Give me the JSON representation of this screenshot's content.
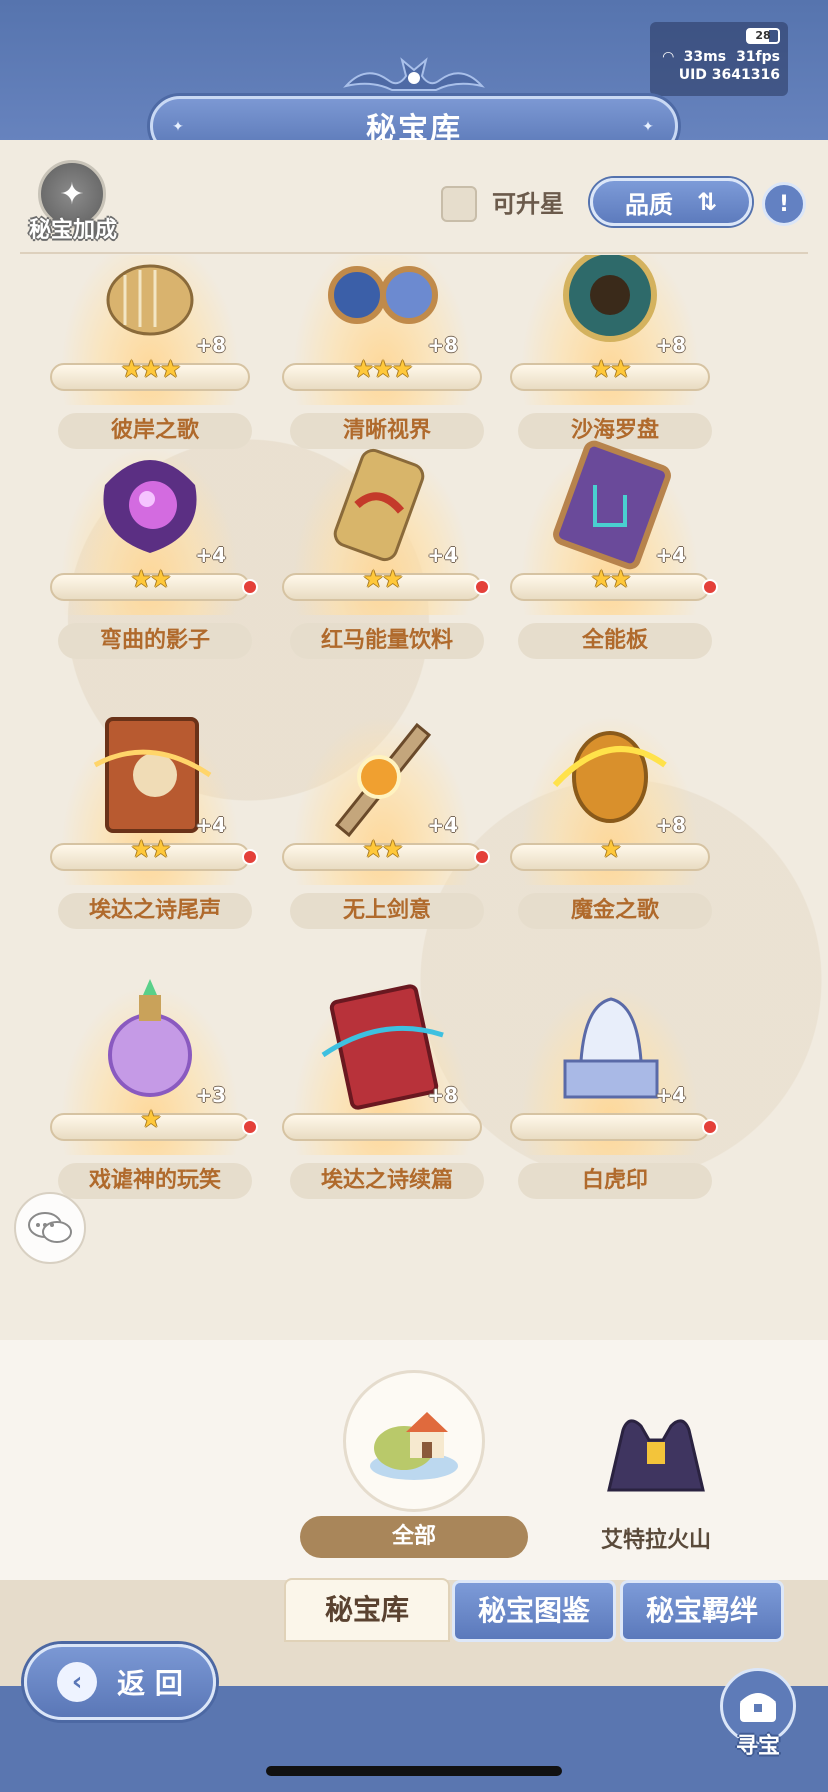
{
  "status": {
    "battery": "28",
    "ping": "33ms",
    "fps": "31fps",
    "uid": "UID 3641316"
  },
  "header": {
    "title": "秘宝库"
  },
  "filter": {
    "bonus_label": "秘宝加成",
    "upgradeable_label": "可升星",
    "quality_label": "品质"
  },
  "items": [
    {
      "name": "彼岸之歌",
      "level": "+8",
      "stars": "★★★",
      "new": false,
      "icon": "lyre-icon"
    },
    {
      "name": "清晰视界",
      "level": "+8",
      "stars": "★★★",
      "new": false,
      "icon": "goggles-icon"
    },
    {
      "name": "沙海罗盘",
      "level": "+8",
      "stars": "★★",
      "new": false,
      "icon": "compass-icon"
    },
    {
      "name": "弯曲的影子",
      "level": "+4",
      "stars": "★★",
      "new": true,
      "icon": "shadow-vortex-icon"
    },
    {
      "name": "红马能量饮料",
      "level": "+4",
      "stars": "★★",
      "new": true,
      "icon": "energy-drink-can-icon"
    },
    {
      "name": "全能板",
      "level": "+4",
      "stars": "★★",
      "new": true,
      "icon": "circuit-board-icon"
    },
    {
      "name": "埃达之诗尾声",
      "level": "+4",
      "stars": "★★",
      "new": true,
      "icon": "book-icon"
    },
    {
      "name": "无上剑意",
      "level": "+4",
      "stars": "★★",
      "new": true,
      "icon": "sword-icon"
    },
    {
      "name": "魔金之歌",
      "level": "+8",
      "stars": "★",
      "new": false,
      "icon": "golden-orb-icon"
    },
    {
      "name": "戏谑神的玩笑",
      "level": "+3",
      "stars": "★",
      "new": true,
      "icon": "potion-bottle-icon"
    },
    {
      "name": "埃达之诗续篇",
      "level": "+8",
      "stars": "",
      "new": false,
      "icon": "red-book-icon"
    },
    {
      "name": "白虎印",
      "level": "+4",
      "stars": "",
      "new": true,
      "icon": "white-tiger-statue-icon"
    }
  ],
  "regions": {
    "all_label": "全部",
    "volcano_label": "艾特拉火山"
  },
  "tabs": {
    "vault": "秘宝库",
    "atlas": "秘宝图鉴",
    "bonds": "秘宝羁绊"
  },
  "nav": {
    "back": "返 回",
    "treasure": "寻宝"
  }
}
